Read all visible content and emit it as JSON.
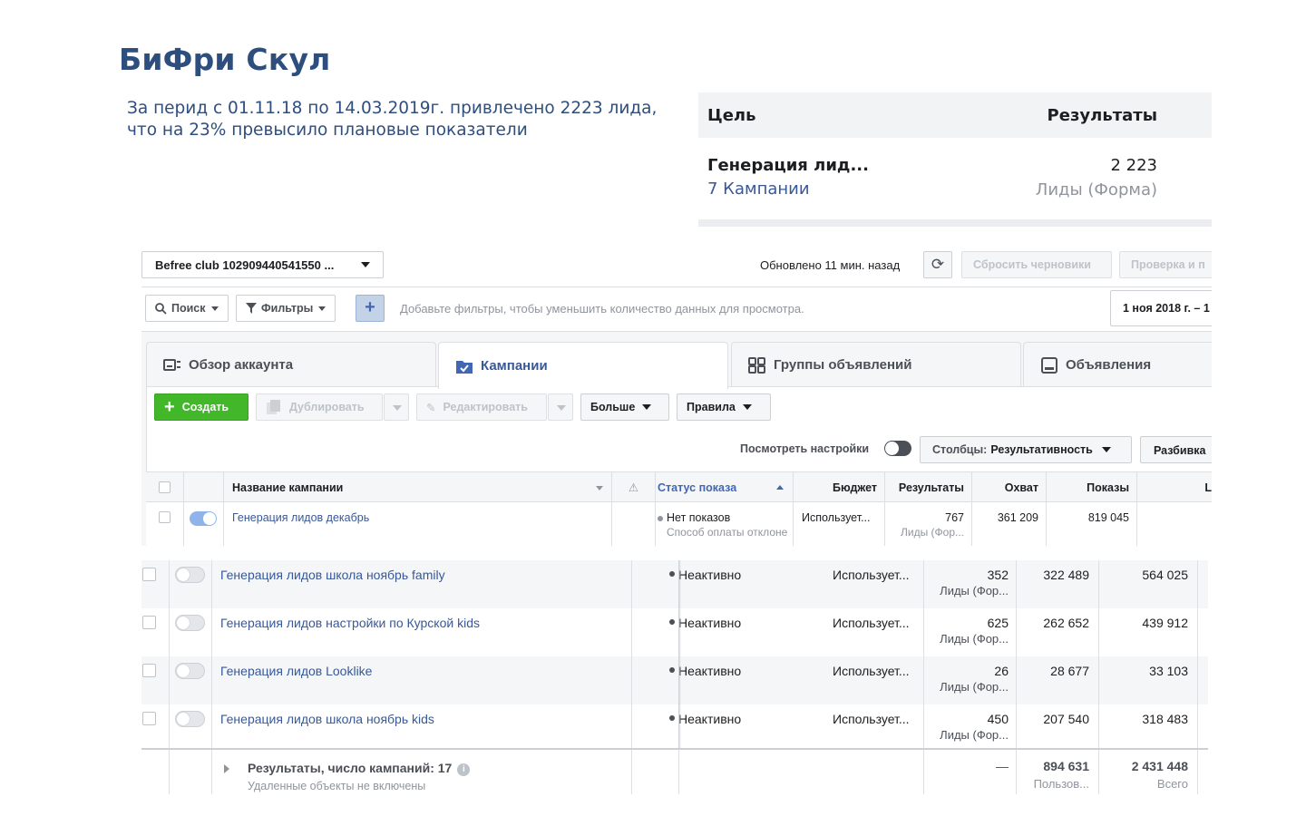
{
  "slide": {
    "title": "БиФри Скул",
    "subtitle_line1": "За перид с 01.11.18 по 14.03.2019г. привлечено 2223 лида,",
    "subtitle_line2": "что на 23% превысило плановые показатели"
  },
  "summary": {
    "goal_header": "Цель",
    "results_header": "Результаты",
    "goal": "Генерация лид...",
    "campaigns_link": "7 Кампании",
    "value": "2 223",
    "unit": "Лиды (Форма)"
  },
  "ads_manager": {
    "account": "Befree club 102909440541550 ...",
    "updated": "Обновлено 11 мин. назад",
    "discard_drafts": "Сбросить черновики",
    "review": "Проверка и п",
    "search": "Поиск",
    "filters": "Фильтры",
    "filter_hint": "Добавьте фильтры, чтобы уменьшить количество данных для просмотра.",
    "date_range": "1 ноя 2018 г. – 1",
    "tabs": [
      "Обзор аккаунта",
      "Кампании",
      "Группы объявлений",
      "Объявления"
    ],
    "actions": {
      "create": "Создать",
      "duplicate": "Дублировать",
      "edit": "Редактировать",
      "more": "Больше",
      "rules": "Правила"
    },
    "view_settings": "Посмотреть настройки",
    "columns_label": "Столбцы:",
    "columns_value": "Результативность",
    "breakdown": "Разбивка",
    "headers": {
      "name": "Название кампании",
      "status": "Статус показа",
      "budget": "Бюджет",
      "results": "Результаты",
      "reach": "Охват",
      "impressions": "Показы",
      "extra": "L"
    },
    "row": {
      "name": "Генерация лидов декабрь",
      "status": "Нет показов",
      "status_note": "Способ оплаты отклоне",
      "budget": "Использует...",
      "results": "767",
      "results_unit": "Лиды (Фор...",
      "reach": "361 209",
      "impressions": "819 045"
    }
  },
  "campaigns": [
    {
      "name": "Генерация лидов школа ноябрь family",
      "status": "Неактивно",
      "budget": "Использует...",
      "results": "352",
      "results_unit": "Лиды (Фор...",
      "reach": "322 489",
      "impressions": "564 025"
    },
    {
      "name": "Генерация лидов настройки по Курской kids",
      "status": "Неактивно",
      "budget": "Использует...",
      "results": "625",
      "results_unit": "Лиды (Фор...",
      "reach": "262 652",
      "impressions": "439 912"
    },
    {
      "name": "Генерация лидов Looklike",
      "status": "Неактивно",
      "budget": "Использует...",
      "results": "26",
      "results_unit": "Лиды (Фор...",
      "reach": "28 677",
      "impressions": "33 103"
    },
    {
      "name": "Генерация лидов школа ноябрь kids",
      "status": "Неактивно",
      "budget": "Использует...",
      "results": "450",
      "results_unit": "Лиды (Фор...",
      "reach": "207 540",
      "impressions": "318 483"
    }
  ],
  "totals": {
    "title": "Результаты, число кампаний: 17",
    "note": "Удаленные объекты не включены",
    "results": "—",
    "reach": "894 631",
    "reach_unit": "Пользов...",
    "impressions": "2 431 448",
    "impressions_unit": "Всего"
  },
  "colors": {
    "title_blue": "#2e4e7e",
    "link_blue": "#385898",
    "create_green": "#42b72a"
  }
}
